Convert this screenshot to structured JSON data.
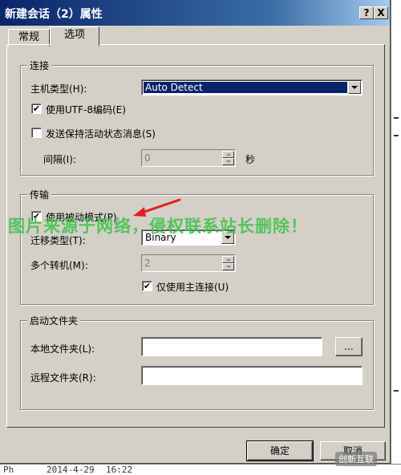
{
  "window": {
    "title": "新建会话（2）属性",
    "help_label": "?",
    "close_label": "X"
  },
  "tabs": [
    {
      "label": "常规"
    },
    {
      "label": "选项"
    }
  ],
  "connection": {
    "group_title": "连接",
    "host_type_label": "主机类型(H):",
    "host_type_value": "Auto Detect",
    "utf8_label": "使用UTF-8编码(E)",
    "utf8_checked": "✔",
    "keepalive_label": "发送保持活动状态消息(S)",
    "keepalive_checked": "",
    "interval_label": "间隔(I):",
    "interval_value": "0",
    "interval_unit": "秒"
  },
  "transfer": {
    "group_title": "传输",
    "passive_label": "使用被动模式(P)",
    "passive_checked": "✔",
    "transfer_type_label": "迁移类型(T):",
    "transfer_type_value": "Binary",
    "multi_label": "多个转机(M):",
    "multi_value": "2",
    "main_only_label": "仅使用主连接(U)",
    "main_only_checked": "✔"
  },
  "startup": {
    "group_title": "启动文件夹",
    "local_label": "本地文件夹(L):",
    "local_value": "",
    "browse_label": "...",
    "remote_label": "远程文件夹(R):",
    "remote_value": ""
  },
  "footer": {
    "ok_label": "确定",
    "cancel_label": "取消"
  },
  "watermark_text": "图片来源于网络，侵权联系站长删除！",
  "background": {
    "bottom_cells": [
      "Ph",
      "2014-4-29",
      "16:22"
    ]
  },
  "logo_text": "创新互联"
}
